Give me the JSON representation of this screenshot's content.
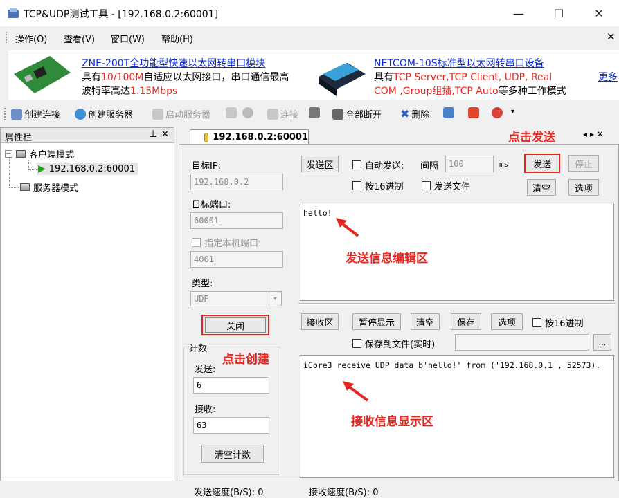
{
  "window": {
    "title": "TCP&UDP测试工具 - [192.168.0.2:60001]"
  },
  "menu": [
    "操作(O)",
    "查看(V)",
    "窗口(W)",
    "帮助(H)"
  ],
  "ad": {
    "left_title": "ZNE-200T全功能型快速以太网转串口模块",
    "left_line2_a": "具有",
    "left_line2_b": "10/100M",
    "left_line2_c": "自适应以太网接口，串口通信最高",
    "left_line3_a": "波特率高达",
    "left_line3_b": "1.15Mbps",
    "right_title": "NETCOM-10S标准型以太网转串口设备",
    "right_line2_a": "具有",
    "right_line2_b": "TCP Server,TCP Client, UDP, Real",
    "right_line3_a": "COM ,Group组播,TCP Auto",
    "right_line3_b": "等多种工作模式",
    "more": "更多"
  },
  "toolbar": {
    "create_conn": "创建连接",
    "create_server": "创建服务器",
    "start_server": "启动服务器",
    "connect": "连接",
    "disconnect_all": "全部断开",
    "delete": "删除"
  },
  "props": {
    "title": "属性栏",
    "pin": "ᵖ",
    "close": "✕"
  },
  "tree": {
    "client_mode": "客户端模式",
    "client_item": "192.168.0.2:60001",
    "server_mode": "服务器模式"
  },
  "tab": {
    "label": "192.168.0.2:60001",
    "nav": "◂ ▸ ✕"
  },
  "form": {
    "target_ip_label": "目标IP:",
    "target_ip": "192.168.0.2",
    "target_port_label": "目标端口:",
    "target_port": "60001",
    "local_port_label": "指定本机端口:",
    "local_port": "4001",
    "type_label": "类型:",
    "type_value": "UDP",
    "close_btn": "关闭",
    "count_label": "计数",
    "sent_label": "发送:",
    "sent": "6",
    "recv_label": "接收:",
    "recv": "63",
    "clear_count": "清空计数"
  },
  "send": {
    "zone": "发送区",
    "auto_send": "自动发送:",
    "interval_label": "间隔",
    "interval": "100",
    "ms": "ms",
    "send_btn": "发送",
    "stop_btn": "停止",
    "hex": "按16进制",
    "send_file": "发送文件",
    "clear": "清空",
    "options": "选项",
    "content": "hello!"
  },
  "recv": {
    "zone": "接收区",
    "pause": "暂停显示",
    "clear": "清空",
    "save": "保存",
    "options": "选项",
    "hex": "按16进制",
    "save_file": "保存到文件(实时)",
    "browse": "...",
    "content": "iCore3 receive UDP data b'hello!' from ('192.168.0.1', 52573)."
  },
  "annotations": {
    "click_send": "点击发送",
    "edit_area": "发送信息编辑区",
    "click_create": "点击创建",
    "recv_area": "接收信息显示区"
  },
  "status": {
    "send_speed": "发送速度(B/S): 0",
    "recv_speed": "接收速度(B/S): 0"
  },
  "colors": {
    "accent_red": "#e6261f",
    "link_blue": "#0b2bd6",
    "play_green": "#1aa31a"
  }
}
